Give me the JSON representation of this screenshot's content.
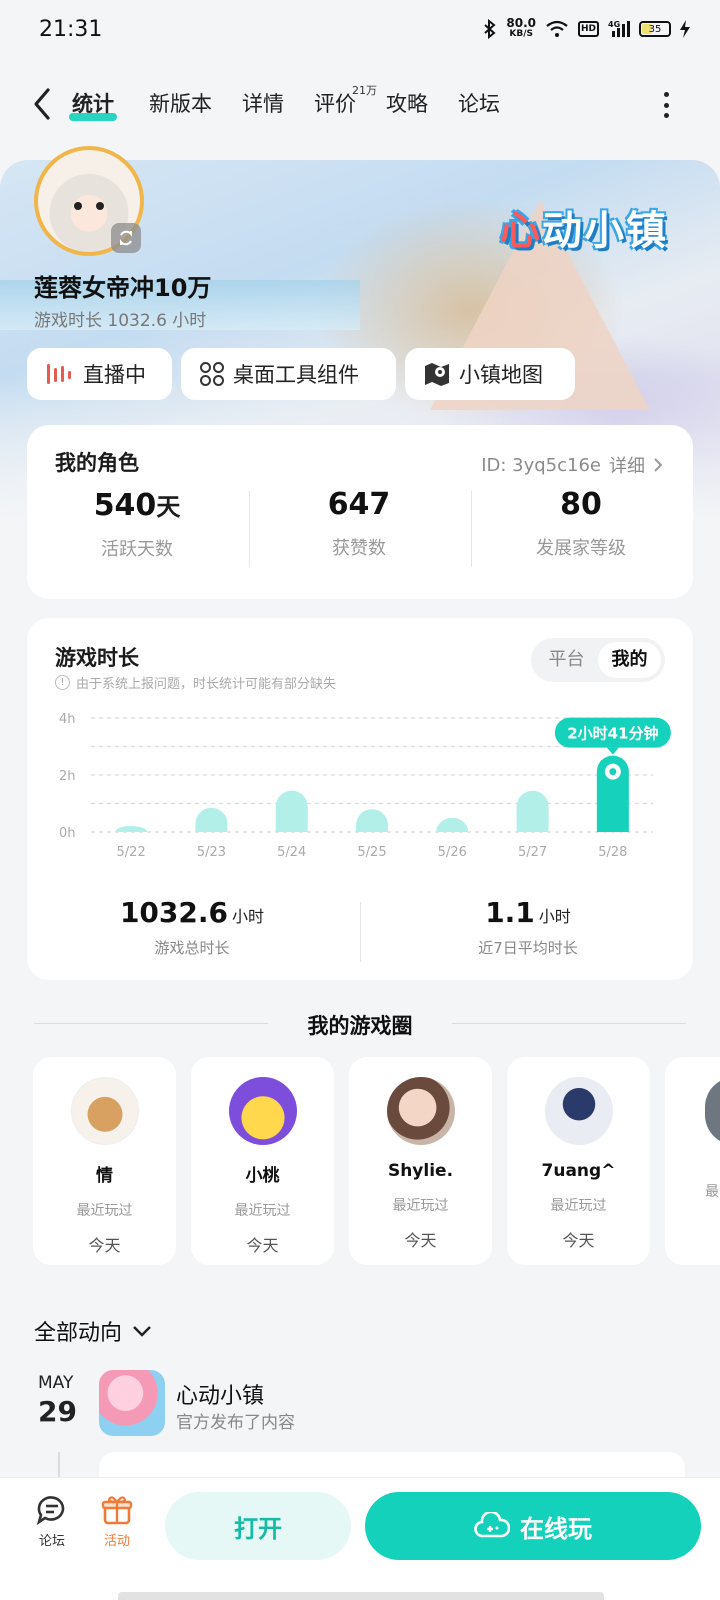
{
  "status": {
    "time": "21:31",
    "speed": "80.0",
    "speed_unit": "KB/S",
    "hd": "HD",
    "net": "4G",
    "battery": "35"
  },
  "nav": {
    "tabs": [
      "统计",
      "新版本",
      "详情",
      "评价",
      "攻略",
      "论坛"
    ],
    "review_badge": "21万"
  },
  "hero": {
    "logo_a": "心",
    "logo_b": "动小镇",
    "name": "莲蓉女帝冲10万",
    "playtime": "游戏时长 1032.6 小时"
  },
  "chips": {
    "live": "直播中",
    "tools": "桌面工具组件",
    "map": "小镇地图"
  },
  "role": {
    "title": "我的角色",
    "id_text": "ID: 3yq5c16e",
    "detail": "详细",
    "stats": [
      {
        "value": "540",
        "unit": "天",
        "label": "活跃天数"
      },
      {
        "value": "647",
        "unit": "",
        "label": "获赞数"
      },
      {
        "value": "80",
        "unit": "",
        "label": "发展家等级"
      }
    ]
  },
  "playtime": {
    "title": "游戏时长",
    "notice": "由于系统上报问题，时长统计可能有部分缺失",
    "toggle": [
      "平台",
      "我的"
    ],
    "total_value": "1032.6",
    "total_unit": "小时",
    "total_label": "游戏总时长",
    "avg_value": "1.1",
    "avg_unit": "小时",
    "avg_label": "近7日平均时长"
  },
  "chart_data": {
    "type": "bar",
    "categories": [
      "5/22",
      "5/23",
      "5/24",
      "5/25",
      "5/26",
      "5/27",
      "5/28"
    ],
    "values": [
      0.2,
      0.85,
      1.45,
      0.8,
      0.5,
      1.45,
      2.68
    ],
    "yticks": [
      "4h",
      "2h",
      "0h"
    ],
    "ylim": [
      0,
      4
    ],
    "highlight_index": 6,
    "highlight_label": "2小时41分钟",
    "grid": true,
    "colors": {
      "bar": "#b3efe9",
      "highlight": "#16d1bb",
      "tooltip": "#16d1bb"
    }
  },
  "circle": {
    "title": "我的游戏圈",
    "friends": [
      {
        "name": "情",
        "sub": "最近玩过",
        "day": "今天"
      },
      {
        "name": "小桃",
        "sub": "最近玩过",
        "day": "今天"
      },
      {
        "name": "Shylie.",
        "sub": "最近玩过",
        "day": "今天"
      },
      {
        "name": "7uang^",
        "sub": "最近玩过",
        "day": "今天"
      },
      {
        "name": "",
        "sub": "最",
        "day": ""
      }
    ]
  },
  "feed": {
    "filter": "全部动向",
    "month": "MAY",
    "day": "29",
    "post_title": "心动小镇",
    "post_sub": "官方发布了内容"
  },
  "bottom": {
    "forum": "论坛",
    "activity": "活动",
    "open": "打开",
    "cloud": "在线玩"
  },
  "colors": {
    "accent": "#13d1bb",
    "activity": "#f07a3a"
  }
}
